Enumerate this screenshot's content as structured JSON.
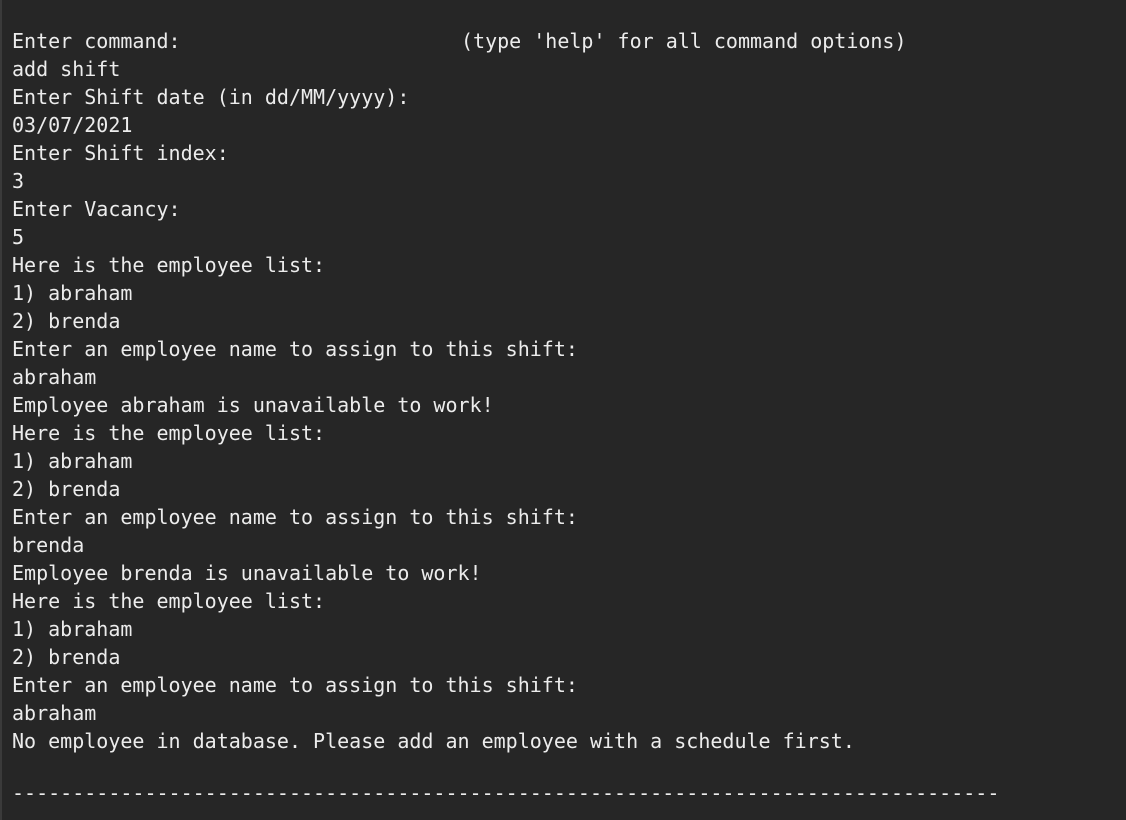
{
  "terminal": {
    "prompt_label": "Enter command:",
    "prompt_hint": "(type 'help' for all command options)",
    "lines": [
      "add shift",
      "Enter Shift date (in dd/MM/yyyy):",
      "03/07/2021",
      "Enter Shift index:",
      "3",
      "Enter Vacancy:",
      "5",
      "Here is the employee list:",
      "1) abraham",
      "2) brenda",
      "Enter an employee name to assign to this shift:",
      "abraham",
      "Employee abraham is unavailable to work!",
      "Here is the employee list:",
      "1) abraham",
      "2) brenda",
      "Enter an employee name to assign to this shift:",
      "brenda",
      "Employee brenda is unavailable to work!",
      "Here is the employee list:",
      "1) abraham",
      "2) brenda",
      "Enter an employee name to assign to this shift:",
      "abraham",
      "No employee in database. Please add an employee with a schedule first."
    ],
    "separator": "----------------------------------------------------------------------------------"
  }
}
